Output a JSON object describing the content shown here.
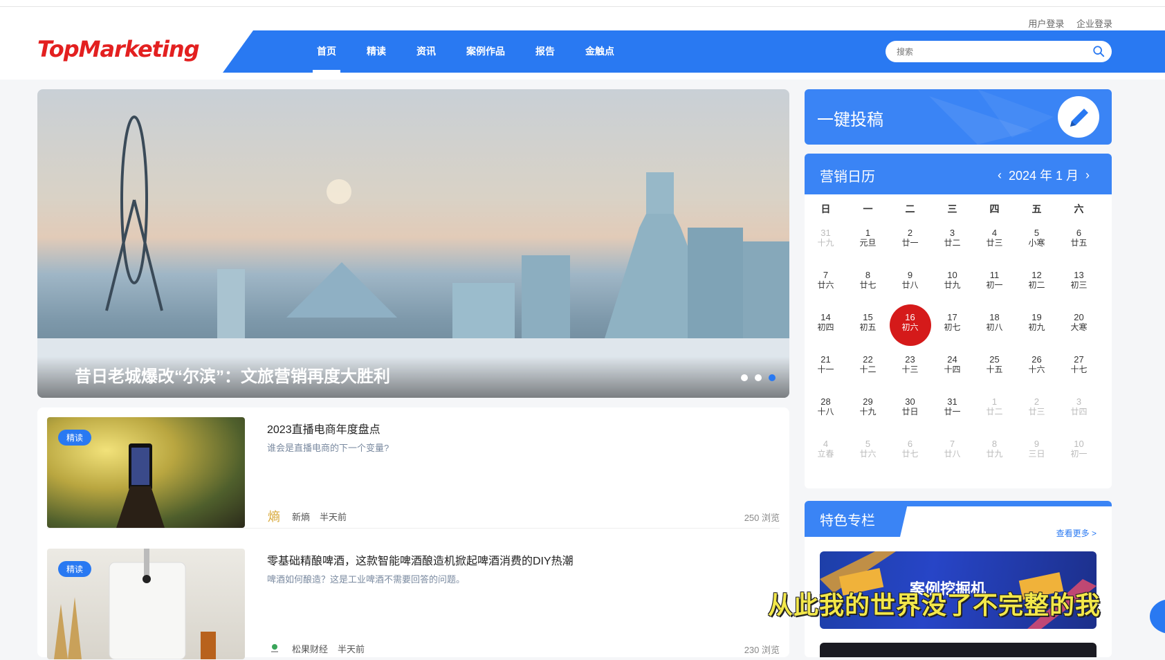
{
  "header": {
    "user_login": "用户登录",
    "company_login": "企业登录",
    "logo": "TopMarketing",
    "nav": [
      "首页",
      "精读",
      "资讯",
      "案例作品",
      "报告",
      "金触点"
    ],
    "search_placeholder": "搜索"
  },
  "hero": {
    "title": "昔日老城爆改“尔滨”：文旅营销再度大胜利",
    "slide_count": 3,
    "active_slide": 3
  },
  "articles": [
    {
      "badge": "精读",
      "title": "2023直播电商年度盘点",
      "subtitle": "谁会是直播电商的下一个变量?",
      "source": "新熵",
      "time": "半天前",
      "views": "250 浏览"
    },
    {
      "badge": "精读",
      "title": "零基础精酿啤酒，这款智能啤酒酿造机掀起啤酒消费的DIY热潮",
      "subtitle": "啤酒如何酿造？这是工业啤酒不需要回答的问题。",
      "source": "松果财经",
      "time": "半天前",
      "views": "230 浏览"
    }
  ],
  "submit": {
    "label": "一键投稿"
  },
  "calendar": {
    "title": "营销日历",
    "month_label": "2024 年 1 月",
    "weekdays": [
      "日",
      "一",
      "二",
      "三",
      "四",
      "五",
      "六"
    ],
    "rows": [
      [
        [
          "31",
          "十九",
          1
        ],
        [
          "1",
          "元旦",
          0
        ],
        [
          "2",
          "廿一",
          0
        ],
        [
          "3",
          "廿二",
          0
        ],
        [
          "4",
          "廿三",
          0
        ],
        [
          "5",
          "小寒",
          0
        ],
        [
          "6",
          "廿五",
          0
        ]
      ],
      [
        [
          "7",
          "廿六",
          0
        ],
        [
          "8",
          "廿七",
          0
        ],
        [
          "9",
          "廿八",
          0
        ],
        [
          "10",
          "廿九",
          0
        ],
        [
          "11",
          "初一",
          0
        ],
        [
          "12",
          "初二",
          0
        ],
        [
          "13",
          "初三",
          0
        ]
      ],
      [
        [
          "14",
          "初四",
          0
        ],
        [
          "15",
          "初五",
          0
        ],
        [
          "16",
          "初六",
          2
        ],
        [
          "17",
          "初七",
          0
        ],
        [
          "18",
          "初八",
          0
        ],
        [
          "19",
          "初九",
          0
        ],
        [
          "20",
          "大寒",
          0
        ]
      ],
      [
        [
          "21",
          "十一",
          0
        ],
        [
          "22",
          "十二",
          0
        ],
        [
          "23",
          "十三",
          0
        ],
        [
          "24",
          "十四",
          0
        ],
        [
          "25",
          "十五",
          0
        ],
        [
          "26",
          "十六",
          0
        ],
        [
          "27",
          "十七",
          0
        ]
      ],
      [
        [
          "28",
          "十八",
          0
        ],
        [
          "29",
          "十九",
          0
        ],
        [
          "30",
          "廿日",
          0
        ],
        [
          "31",
          "廿一",
          0
        ],
        [
          "1",
          "廿二",
          1
        ],
        [
          "2",
          "廿三",
          1
        ],
        [
          "3",
          "廿四",
          1
        ]
      ],
      [
        [
          "4",
          "立春",
          1
        ],
        [
          "5",
          "廿六",
          1
        ],
        [
          "6",
          "廿七",
          1
        ],
        [
          "7",
          "廿八",
          1
        ],
        [
          "8",
          "廿九",
          1
        ],
        [
          "9",
          "三日",
          1
        ],
        [
          "10",
          "初一",
          1
        ]
      ]
    ]
  },
  "special": {
    "title": "特色专栏",
    "more": "查看更多 >",
    "banner_text": "案例挖掘机"
  },
  "overlay_subtitle": "从此我的世界没了不完整的我",
  "colors": {
    "brand_blue": "#2979f2",
    "logo_red": "#e32020",
    "today_red": "#d51a1a"
  }
}
